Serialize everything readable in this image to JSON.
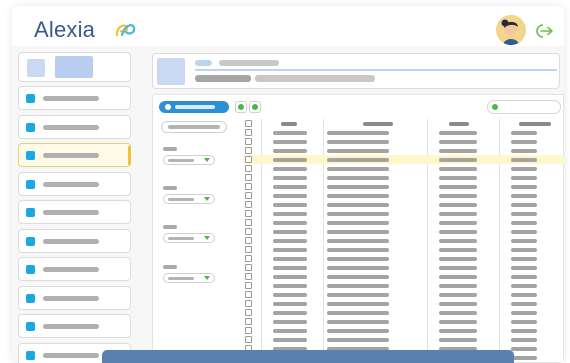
{
  "app": {
    "brand": "Alexia",
    "colors": {
      "brand": "#3a5a8c",
      "accent": "#2e8fd4",
      "active": "#f0c23a",
      "highlight": "#fff6c9",
      "banner": "#5b7fae"
    }
  },
  "header": {
    "logo_icon": "alexia-logo-mark",
    "avatar_icon": "user-avatar",
    "logout_icon": "logout-icon"
  },
  "sidebar": {
    "active_index": 2,
    "item_count": 10
  },
  "table": {
    "highlighted_row": 4,
    "row_count": 27
  }
}
